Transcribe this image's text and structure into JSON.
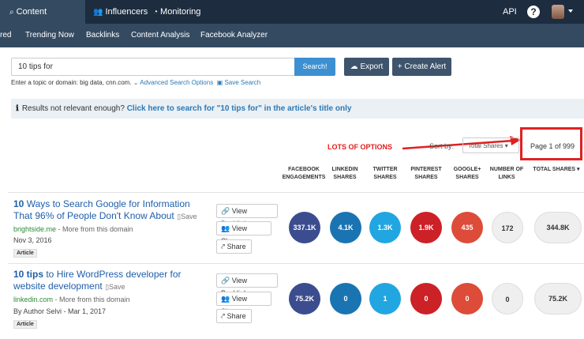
{
  "topnav": {
    "tabs": [
      {
        "label": "Content Research",
        "icon": "search-icon"
      },
      {
        "label": "Influencers",
        "icon": "users-icon"
      },
      {
        "label": "Monitoring",
        "icon": "dashboard-icon"
      }
    ],
    "api": "API"
  },
  "subnav": {
    "tabs": [
      "red",
      "Trending Now",
      "Backlinks",
      "Content Analysis",
      "Facebook Analyzer"
    ]
  },
  "search": {
    "value": "10 tips for",
    "button": "Search!",
    "export": "Export",
    "create_alert": "+ Create Alert",
    "hint": "Enter a topic or domain: big data, cnn.com.",
    "advanced": "Advanced Search Options",
    "save_search": "Save Search"
  },
  "infobar": {
    "text": "Results not relevant enough?",
    "link": "Click here to search for \"10 tips for\" in the article's title only"
  },
  "annotation": "LOTS OF OPTIONS",
  "sort": {
    "label": "Sort by:",
    "value": "Total Shares"
  },
  "pagination": "Page 1 of 999",
  "columns": [
    "FACEBOOK ENGAGEMENTS",
    "LINKEDIN SHARES",
    "TWITTER SHARES",
    "PINTEREST SHARES",
    "GOOGLE+ SHARES",
    "NUMBER OF LINKS",
    "TOTAL SHARES"
  ],
  "actions": {
    "backlinks": "View Backlinks",
    "sharers": "View Sharers",
    "share": "Share"
  },
  "results": [
    {
      "title_bold": "10",
      "title_rest": " Ways to Search Google for Information",
      "title_line2": "That 96% of People Don't Know About",
      "save": "Save",
      "domain": "brightside.me",
      "more": " - More from this domain",
      "date": "Nov 3, 2016",
      "badge": "Article",
      "stats": {
        "facebook": "337.1K",
        "linkedin": "4.1K",
        "twitter": "1.3K",
        "pinterest": "1.9K",
        "google": "435",
        "links": "172",
        "total": "344.8K"
      }
    },
    {
      "title_bold": "10 tips",
      "title_rest": " to Hire WordPress developer for",
      "title_line2": "website development",
      "save": "Save",
      "domain": "linkedin.com",
      "more": " - More from this domain",
      "date": "By Author Selvi - Mar 1, 2017",
      "badge": "Article",
      "stats": {
        "facebook": "75.2K",
        "linkedin": "0",
        "twitter": "1",
        "pinterest": "0",
        "google": "0",
        "links": "0",
        "total": "75.2K"
      }
    }
  ],
  "colors": {
    "facebook": "#3b4d8f",
    "linkedin": "#1a74b2",
    "twitter": "#22a6e1",
    "pinterest": "#cc2127",
    "google": "#dd4b39",
    "highlight": "#e02121"
  }
}
